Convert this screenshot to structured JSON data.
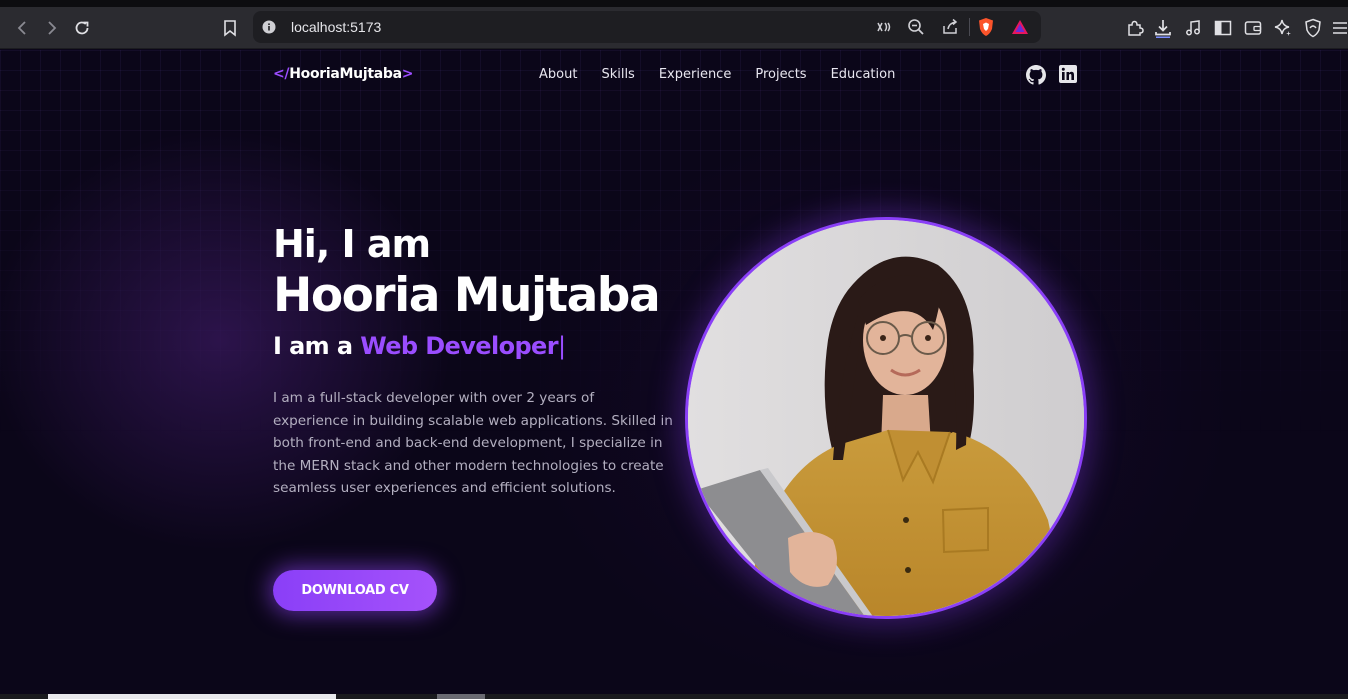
{
  "browser": {
    "url": "localhost:5173",
    "icons": {
      "back": "back-arrow-icon",
      "forward": "forward-arrow-icon",
      "reload": "reload-icon",
      "bookmark": "bookmark-icon",
      "site_info": "info-icon",
      "reader": "reader-mode-icon",
      "zoom": "zoom-out-icon",
      "share": "share-icon",
      "shield": "brave-shields-icon",
      "rewards": "brave-rewards-icon",
      "extensions": "puzzle-icon",
      "downloads": "download-icon",
      "media": "music-note-icon",
      "sidebar": "sidebar-icon",
      "wallet": "wallet-icon",
      "leo": "sparkle-icon",
      "vpn": "vpn-shield-icon",
      "menu": "hamburger-menu-icon"
    }
  },
  "site": {
    "logo": {
      "open": "</",
      "text": "HooriaMujtaba",
      "close": ">"
    },
    "nav": [
      {
        "label": "About"
      },
      {
        "label": "Skills"
      },
      {
        "label": "Experience"
      },
      {
        "label": "Projects"
      },
      {
        "label": "Education"
      }
    ],
    "social": {
      "github_icon": "github-icon",
      "linkedin_icon": "linkedin-icon"
    }
  },
  "hero": {
    "greeting": "Hi, I am",
    "name": "Hooria Mujtaba",
    "role_prefix": "I am a ",
    "role_highlight": "Web Developer",
    "caret": "|",
    "bio": "I am a full-stack developer with over 2 years of experience in building scalable web applications. Skilled in both front-end and back-end development, I specialize in the MERN stack and other modern technologies to create seamless user experiences and efficient solutions.",
    "cta_label": "DOWNLOAD CV"
  },
  "colors": {
    "accent": "#9a4dff",
    "background": "#0b0619",
    "button_start": "#8a3ff7",
    "button_end": "#a552fb"
  }
}
